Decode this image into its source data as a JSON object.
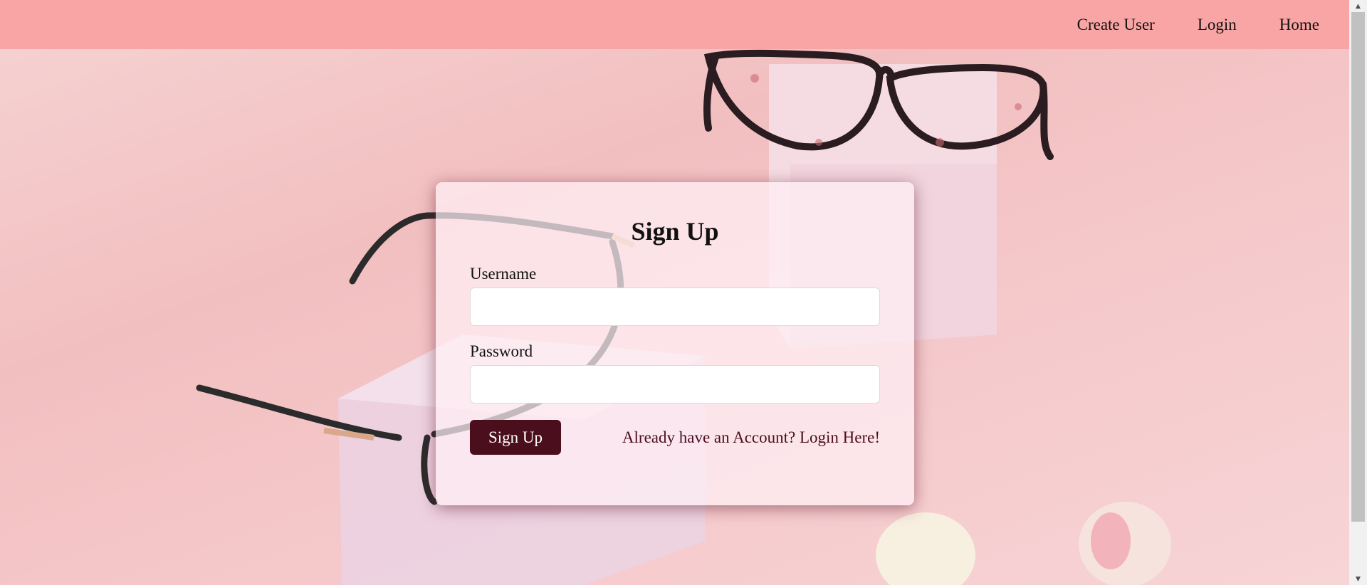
{
  "nav": {
    "items": [
      {
        "label": "Create User"
      },
      {
        "label": "Login"
      },
      {
        "label": "Home"
      }
    ]
  },
  "form": {
    "title": "Sign Up",
    "username_label": "Username",
    "username_value": "",
    "password_label": "Password",
    "password_value": "",
    "submit_label": "Sign Up",
    "login_link": "Already have an Account? Login Here!"
  },
  "colors": {
    "navbar": "#f9a5a5",
    "background": "#f4c4c4",
    "button": "#4b0e1d",
    "link": "#4b0e1d"
  }
}
